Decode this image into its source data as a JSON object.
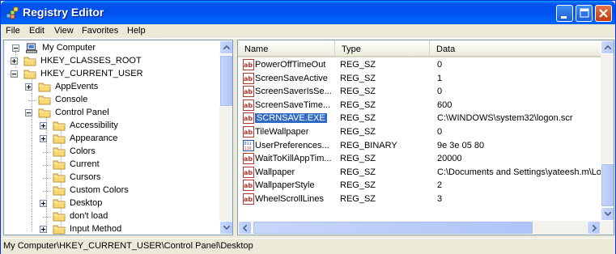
{
  "window": {
    "title": "Registry Editor"
  },
  "menu": [
    "File",
    "Edit",
    "View",
    "Favorites",
    "Help"
  ],
  "tree": {
    "root": "My Computer",
    "nodes": [
      {
        "label": "HKEY_CLASSES_ROOT",
        "expander": "plus"
      },
      {
        "label": "HKEY_CURRENT_USER",
        "expander": "minus"
      },
      {
        "label": "AppEvents",
        "expander": "plus"
      },
      {
        "label": "Console",
        "expander": "none"
      },
      {
        "label": "Control Panel",
        "expander": "minus"
      },
      {
        "label": "Accessibility",
        "expander": "plus"
      },
      {
        "label": "Appearance",
        "expander": "plus"
      },
      {
        "label": "Colors",
        "expander": "none"
      },
      {
        "label": "Current",
        "expander": "none"
      },
      {
        "label": "Cursors",
        "expander": "none"
      },
      {
        "label": "Custom Colors",
        "expander": "none"
      },
      {
        "label": "Desktop",
        "expander": "plus"
      },
      {
        "label": "don't load",
        "expander": "none"
      },
      {
        "label": "Input Method",
        "expander": "plus"
      }
    ]
  },
  "list": {
    "columns": [
      "Name",
      "Type",
      "Data"
    ],
    "rows": [
      {
        "name": "PowerOffTimeOut",
        "type": "REG_SZ",
        "data": "0",
        "icon": "string-value-icon"
      },
      {
        "name": "ScreenSaveActive",
        "type": "REG_SZ",
        "data": "1",
        "icon": "string-value-icon"
      },
      {
        "name": "ScreenSaverIsSe...",
        "type": "REG_SZ",
        "data": "0",
        "icon": "string-value-icon"
      },
      {
        "name": "ScreenSaveTime...",
        "type": "REG_SZ",
        "data": "600",
        "icon": "string-value-icon"
      },
      {
        "name": "SCRNSAVE.EXE",
        "type": "REG_SZ",
        "data": "C:\\WINDOWS\\system32\\logon.scr",
        "icon": "string-value-icon",
        "selected": true
      },
      {
        "name": "TileWallpaper",
        "type": "REG_SZ",
        "data": "0",
        "icon": "string-value-icon"
      },
      {
        "name": "UserPreferences...",
        "type": "REG_BINARY",
        "data": "9e 3e 05 80",
        "icon": "binary-value-icon"
      },
      {
        "name": "WaitToKillAppTim...",
        "type": "REG_SZ",
        "data": "20000",
        "icon": "string-value-icon"
      },
      {
        "name": "Wallpaper",
        "type": "REG_SZ",
        "data": "C:\\Documents and Settings\\yateesh.m\\Lo",
        "icon": "string-value-icon"
      },
      {
        "name": "WallpaperStyle",
        "type": "REG_SZ",
        "data": "2",
        "icon": "string-value-icon"
      },
      {
        "name": "WheelScrollLines",
        "type": "REG_SZ",
        "data": "3",
        "icon": "string-value-icon"
      }
    ]
  },
  "status": "My Computer\\HKEY_CURRENT_USER\\Control Panel\\Desktop",
  "colors": {
    "title_blue": "#0053EE",
    "selection": "#316AC5",
    "chrome": "#ECE9D8"
  }
}
